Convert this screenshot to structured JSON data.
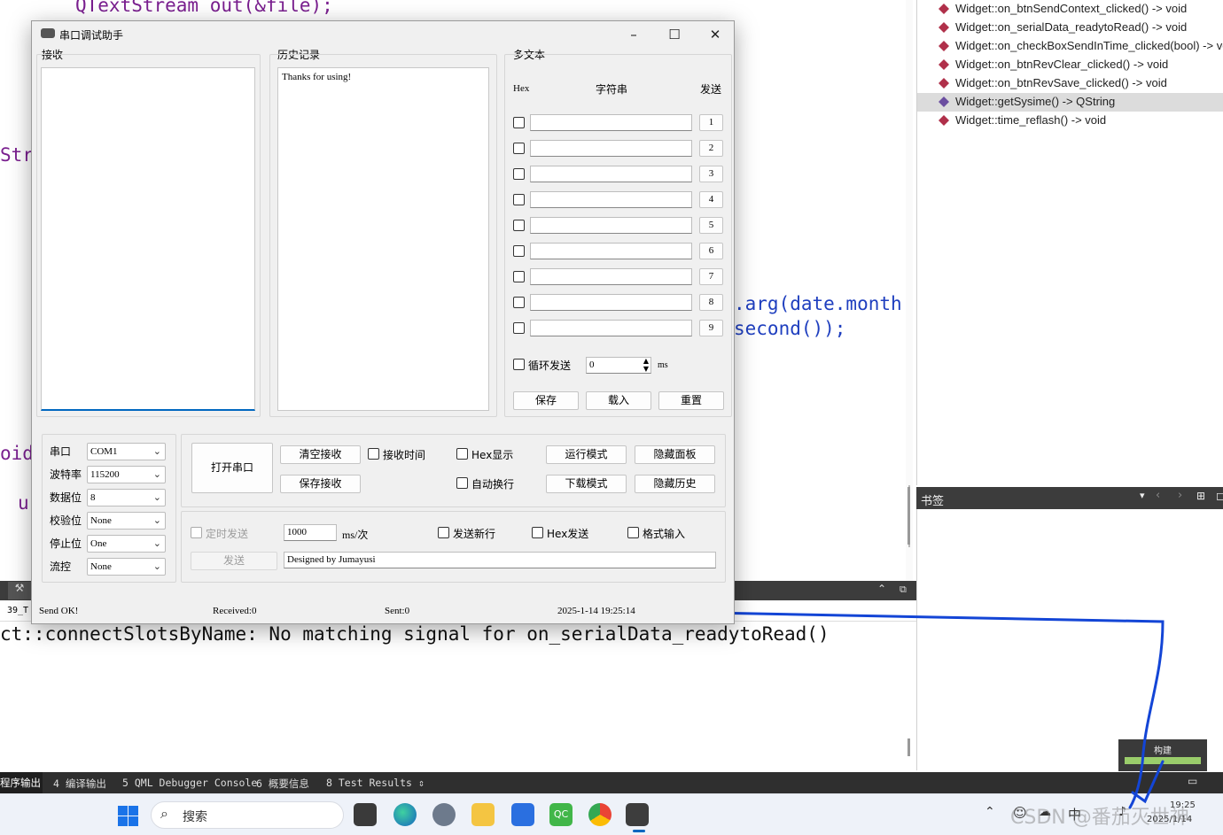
{
  "editor": {
    "line1": "QTextStream out(&file);",
    "frag_str": "Str",
    "frag_oid": "oid",
    "frag_u": "u",
    "frag_arg1": ".arg(date.month",
    "frag_arg2": "second());"
  },
  "outline": {
    "items": [
      "Widget::on_btnSendContext_clicked() -> void",
      "Widget::on_serialData_readytoRead() -> void",
      "Widget::on_checkBoxSendInTime_clicked(bool) -> vo",
      "Widget::on_btnRevClear_clicked() -> void",
      "Widget::on_btnRevSave_clicked() -> void",
      "Widget::getSysime() -> QString",
      "Widget::time_reflash() -> void"
    ],
    "selected_index": 5
  },
  "bookmarks": {
    "title": "书签"
  },
  "output": {
    "line1_prefix": "39_T",
    "line2": "ct::connectSlotsByName: No matching signal for on_serialData_readytoRead()",
    "tabs": [
      "程序输出",
      "4  编译输出",
      "5  QML Debugger Console",
      "6  概要信息",
      "8  Test Results"
    ]
  },
  "build_popup": {
    "label": "构建"
  },
  "taskbar": {
    "search_placeholder": "搜索",
    "ime": "中",
    "time": "19:25",
    "date": "2025/1/14",
    "watermark": "CSDN @番茄灭世神"
  },
  "dialog": {
    "title": "串口调试助手",
    "receive_group": "接收",
    "history_group": "历史记录",
    "history_text": "Thanks for using!",
    "multitext_group": "多文本",
    "col_hex": "Hex",
    "col_string": "字符串",
    "col_send": "发送",
    "rows": [
      {
        "btn": "1",
        "value": ""
      },
      {
        "btn": "2",
        "value": ""
      },
      {
        "btn": "3",
        "value": ""
      },
      {
        "btn": "4",
        "value": ""
      },
      {
        "btn": "5",
        "value": ""
      },
      {
        "btn": "6",
        "value": ""
      },
      {
        "btn": "7",
        "value": ""
      },
      {
        "btn": "8",
        "value": ""
      },
      {
        "btn": "9",
        "value": ""
      }
    ],
    "loop_send_label": "循环发送",
    "loop_value": "0",
    "loop_unit": "ms",
    "save_btn": "保存",
    "load_btn": "载入",
    "reset_btn": "重置",
    "serial": {
      "port_label": "串口",
      "port_value": "COM1",
      "baud_label": "波特率",
      "baud_value": "115200",
      "data_label": "数据位",
      "data_value": "8",
      "parity_label": "校验位",
      "parity_value": "None",
      "stop_label": "停止位",
      "stop_value": "One",
      "flow_label": "流控",
      "flow_value": "None"
    },
    "open_port_btn": "打开串口",
    "clear_recv_btn": "清空接收",
    "save_recv_btn": "保存接收",
    "recv_time_label": "接收时间",
    "hex_display_label": "Hex显示",
    "auto_wrap_label": "自动换行",
    "run_mode_btn": "运行模式",
    "download_mode_btn": "下载模式",
    "hide_panel_btn": "隐藏面板",
    "hide_history_btn": "隐藏历史",
    "timed_send_label": "定时发送",
    "interval_value": "1000",
    "interval_unit": "ms/次",
    "send_newline_label": "发送新行",
    "hex_send_label": "Hex发送",
    "format_input_label": "格式输入",
    "send_btn": "发送",
    "send_text": "Designed by Jumayusi",
    "status_send": "Send OK!",
    "status_received": "Received:0",
    "status_sent": "Sent:0",
    "status_time": "2025-1-14 19:25:14"
  },
  "colors": {
    "annotation_blue": "#1345d6",
    "code_purple": "#7a1f8f",
    "code_blue": "#1f3fbf",
    "code_dark": "#1b1b5a"
  }
}
